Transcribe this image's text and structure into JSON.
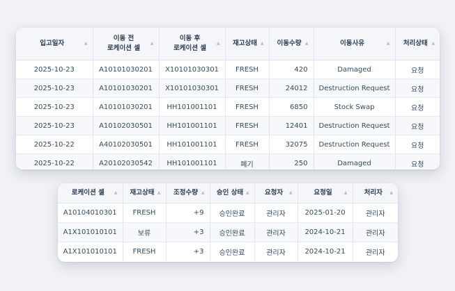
{
  "transfer_table": {
    "columns": [
      {
        "label": "입고일자"
      },
      {
        "label": "이동 전\n로케이션 셀"
      },
      {
        "label": "이동 후\n로케이션 셀"
      },
      {
        "label": "재고상태"
      },
      {
        "label": "이동수량"
      },
      {
        "label": "이동사유"
      },
      {
        "label": "처리상태"
      }
    ],
    "rows": [
      [
        "2025-10-23",
        "A10101030201",
        "X10101030301",
        "FRESH",
        "420",
        "Damaged",
        "요청"
      ],
      [
        "2025-10-23",
        "A10101030201",
        "X10101030301",
        "FRESH",
        "24012",
        "Destruction Request",
        "요청"
      ],
      [
        "2025-10-23",
        "A10101030201",
        "HH101001101",
        "FRESH",
        "6850",
        "Stock Swap",
        "요청"
      ],
      [
        "2025-10-23",
        "A10102030501",
        "HH101001101",
        "FRESH",
        "12401",
        "Destruction Request",
        "요청"
      ],
      [
        "2025-10-22",
        "A40102030501",
        "HH101001101",
        "FRESH",
        "32075",
        "Destruction Request",
        "요청"
      ],
      [
        "2025-10-22",
        "A20102030542",
        "HH101001101",
        "폐기",
        "250",
        "Damaged",
        "요청"
      ]
    ]
  },
  "adjust_table": {
    "columns": [
      {
        "label": "로케이션 셀"
      },
      {
        "label": "재고상태"
      },
      {
        "label": "조정수량"
      },
      {
        "label": "승인 상태"
      },
      {
        "label": "요청자"
      },
      {
        "label": "요청일"
      },
      {
        "label": "처리자"
      }
    ],
    "rows": [
      [
        "A10104010301",
        "FRESH",
        "+9",
        "승인완료",
        "관리자",
        "2025-01-20",
        "관리자"
      ],
      [
        "A1X101010101",
        "보류",
        "+3",
        "승인완료",
        "관리자",
        "2024-10-21",
        "관리자"
      ],
      [
        "A1X101010101",
        "FRESH",
        "+3",
        "승인완료",
        "관리자",
        "2024-10-21",
        "관리자"
      ]
    ]
  },
  "icons": {
    "sort": "sort-triangle-icon",
    "sort_glyph": "▲"
  }
}
